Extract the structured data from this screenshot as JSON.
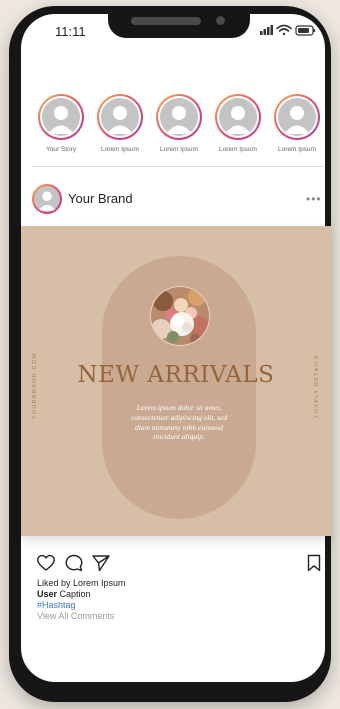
{
  "status_bar": {
    "time": "11:11"
  },
  "stories": [
    {
      "label": "Your Story"
    },
    {
      "label": "Lorem Ipsum"
    },
    {
      "label": "Lorem Ipsum"
    },
    {
      "label": "Lorem Ipsum"
    },
    {
      "label": "Lorem Ipsum"
    }
  ],
  "post": {
    "brand_name": "Your Brand",
    "more_icon": "more-horizontal-icon",
    "image": {
      "headline": "NEW ARRIVALS",
      "body": "Lorem ipsum dolor sit amet, consectetuer adipiscing elit, sed diam nonummy nibh euismod tincidunt aliquip.",
      "side_left": "YOURBRAND.COM",
      "side_right": "LOVELY DETAILS",
      "background_color": "#d7bea7",
      "pill_color": "#c9a991",
      "headline_color": "#98643a"
    },
    "actions": {
      "like": "heart-icon",
      "comment": "comment-icon",
      "share": "send-icon",
      "save": "bookmark-icon"
    },
    "caption": {
      "liked_by": "Liked by Lorem Ipsum",
      "user": "User",
      "text": "Caption",
      "hashtag": "#Hashtag",
      "view_comments": "View All Comments"
    }
  },
  "colors": {
    "story_ring_start": "#f6b24c",
    "story_ring_mid": "#e2476d",
    "story_ring_end": "#b13fa0",
    "hashtag": "#3b79c4",
    "phone_frame": "#161616",
    "background": "#ede7e0"
  }
}
